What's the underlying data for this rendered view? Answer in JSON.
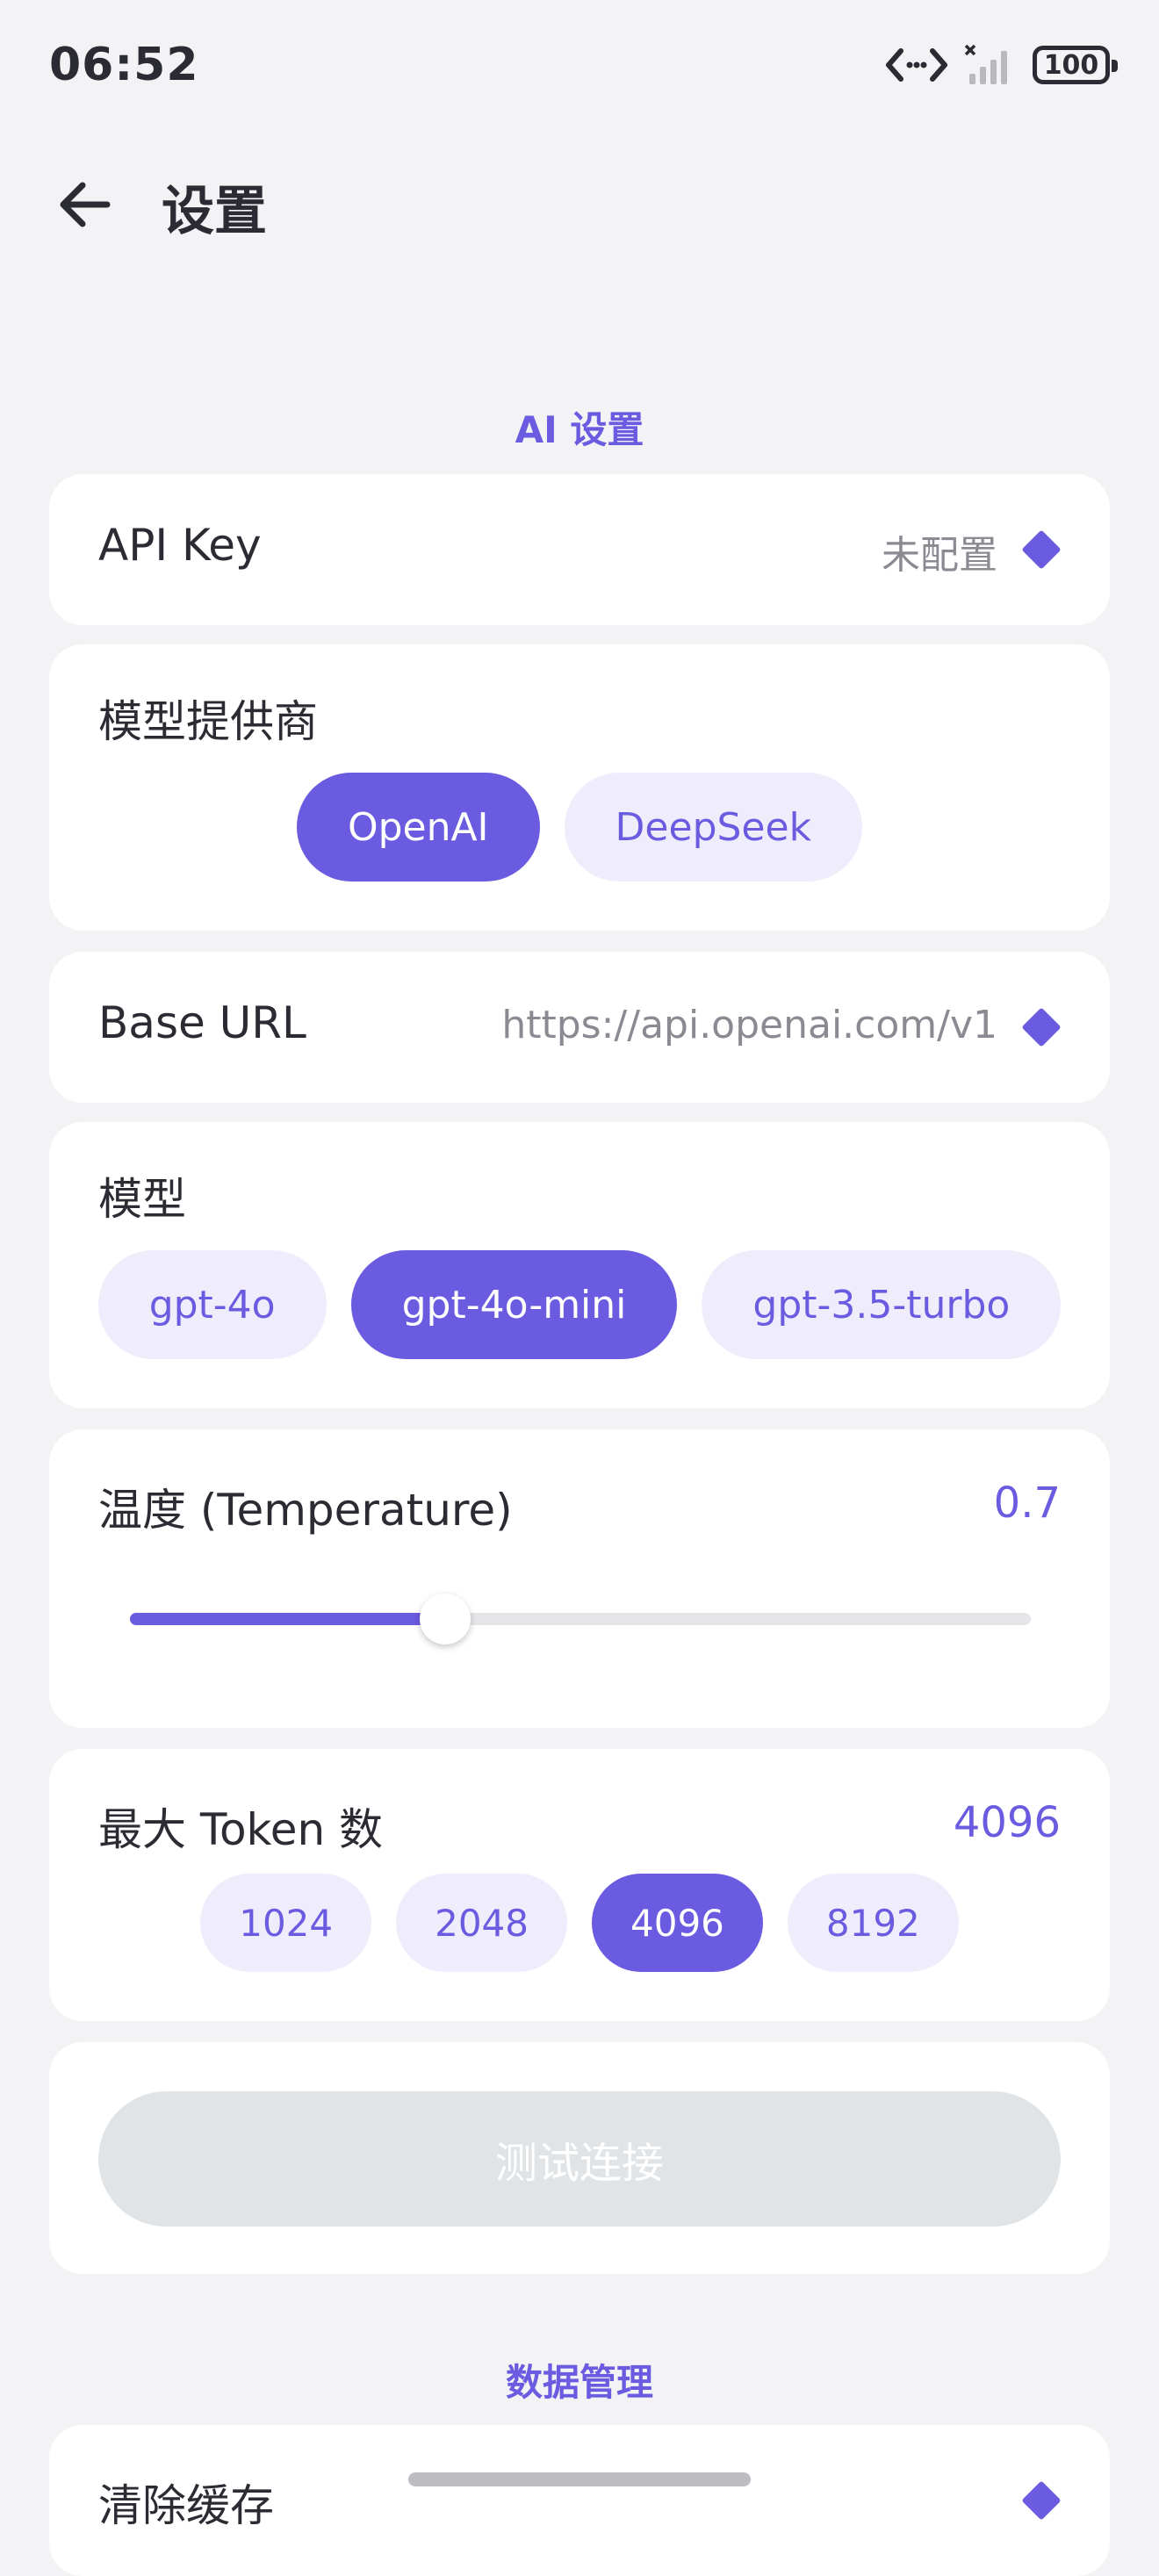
{
  "status_bar": {
    "time": "06:52",
    "battery": "100"
  },
  "header": {
    "title": "设置"
  },
  "sections": {
    "ai": "AI 设置",
    "data": "数据管理"
  },
  "api_key": {
    "label": "API Key",
    "value": "未配置"
  },
  "provider": {
    "label": "模型提供商",
    "options": [
      {
        "label": "OpenAI",
        "active": true
      },
      {
        "label": "DeepSeek",
        "active": false
      }
    ]
  },
  "base_url": {
    "label": "Base URL",
    "value": "https://api.openai.com/v1"
  },
  "model": {
    "label": "模型",
    "options": [
      {
        "label": "gpt-4o",
        "active": false
      },
      {
        "label": "gpt-4o-mini",
        "active": true
      },
      {
        "label": "gpt-3.5-turbo",
        "active": false
      }
    ]
  },
  "temperature": {
    "label": "温度 (Temperature)",
    "value": "0.7",
    "slider_level": 0.35
  },
  "max_tokens": {
    "label": "最大 Token 数",
    "value": "4096",
    "options": [
      {
        "label": "1024",
        "active": false
      },
      {
        "label": "2048",
        "active": false
      },
      {
        "label": "4096",
        "active": true
      },
      {
        "label": "8192",
        "active": false
      }
    ]
  },
  "test_button": {
    "label": "测试连接"
  },
  "clear_cache": {
    "label": "清除缓存"
  },
  "colors": {
    "accent": "#6B5BE0",
    "accent_light": "#EFEDFC",
    "background": "#F3F3F6",
    "card": "#FFFFFF",
    "disabled_button": "#E1E4E6"
  }
}
